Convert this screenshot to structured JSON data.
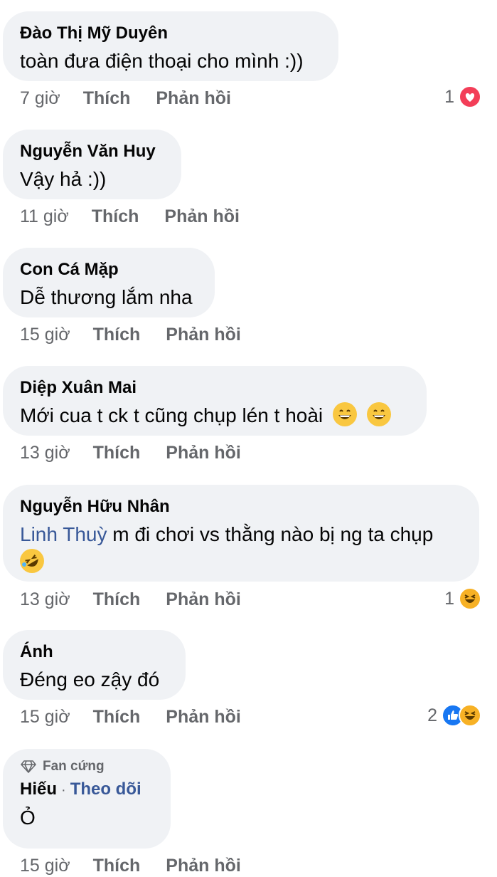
{
  "comments": [
    {
      "name": "Đào Thị Mỹ Duyên",
      "text": "toàn đưa điện thoại cho mình :))",
      "time": "7 giờ",
      "like": "Thích",
      "reply": "Phản hồi",
      "reaction_count": "1"
    },
    {
      "name": "Nguyễn Văn Huy",
      "text": "Vậy hả :))",
      "time": "11 giờ",
      "like": "Thích",
      "reply": "Phản hồi"
    },
    {
      "name": "Con Cá Mặp",
      "text": "Dễ thương lắm nha",
      "time": "15 giờ",
      "like": "Thích",
      "reply": "Phản hồi"
    },
    {
      "name": "Diệp Xuân Mai",
      "text": "Mới cua t ck t cũng chụp lén t hoài",
      "time": "13 giờ",
      "like": "Thích",
      "reply": "Phản hồi"
    },
    {
      "name": "Nguyễn Hữu Nhân",
      "mention": "Linh Thuỳ",
      "text": " m đi chơi vs thằng nào bị ng ta chụp",
      "time": "13 giờ",
      "like": "Thích",
      "reply": "Phản hồi",
      "reaction_count": "1"
    },
    {
      "name": "Ánh",
      "text": "Đéng eo zậy đó",
      "time": "15 giờ",
      "like": "Thích",
      "reply": "Phản hồi",
      "reaction_count": "2"
    },
    {
      "badge": "Fan cứng",
      "name": "Hiếu",
      "follow": "Theo dõi",
      "dot": "·",
      "text": "Ỏ",
      "time": "15 giờ",
      "like": "Thích",
      "reply": "Phản hồi"
    }
  ],
  "icons": {
    "heart": "heart-reaction",
    "like": "like-reaction",
    "haha": "haha-reaction",
    "grin": "grinning-emoji",
    "rofl": "rolling-laughing-emoji",
    "diamond": "diamond-icon"
  },
  "colors": {
    "bubble": "#f0f2f5",
    "meta": "#65676b",
    "link": "#385898",
    "heart": "#f33e58",
    "like": "#1877f2",
    "haha": "#f7b125"
  }
}
